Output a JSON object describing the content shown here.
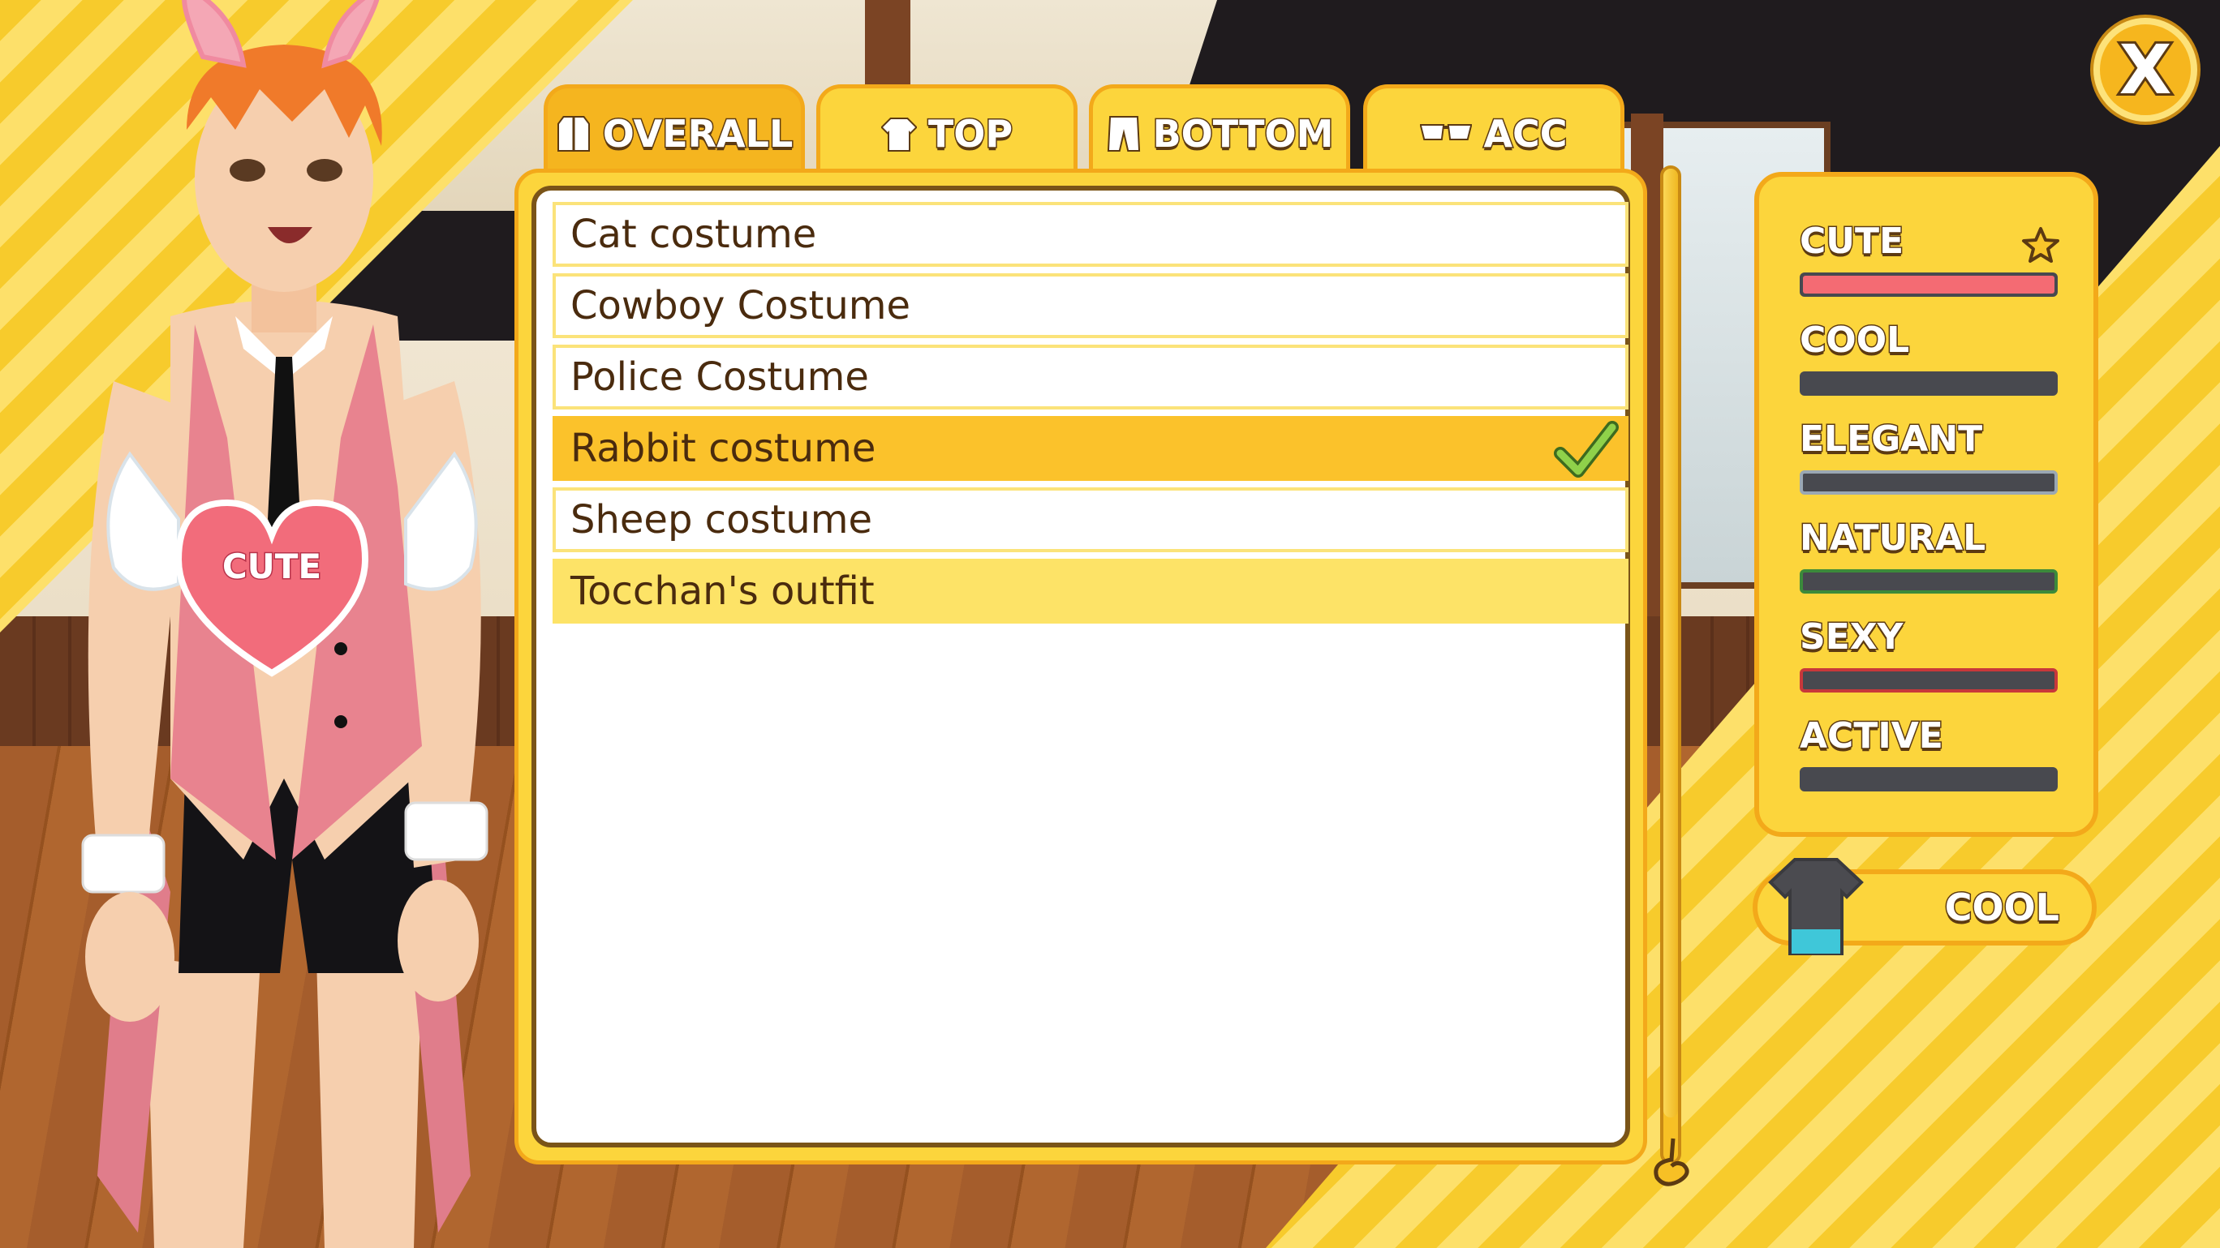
{
  "tabs": [
    {
      "label": "OVERALL",
      "icon": "overall-icon",
      "active": true
    },
    {
      "label": "TOP",
      "icon": "shirt-icon",
      "active": false
    },
    {
      "label": "BOTTOM",
      "icon": "pants-icon",
      "active": false
    },
    {
      "label": "ACC",
      "icon": "glasses-icon",
      "active": false
    }
  ],
  "outfits": [
    {
      "name": "Cat costume",
      "state": "normal"
    },
    {
      "name": "Cowboy Costume",
      "state": "normal"
    },
    {
      "name": "Police Costume",
      "state": "normal"
    },
    {
      "name": "Rabbit costume",
      "state": "selected"
    },
    {
      "name": "Sheep costume",
      "state": "normal"
    },
    {
      "name": "Tocchan's outfit",
      "state": "hover"
    }
  ],
  "character": {
    "style_badge": "CUTE"
  },
  "stats": [
    {
      "label": "CUTE",
      "color": "#f46b73",
      "value": 1.0,
      "starred": true
    },
    {
      "label": "COOL",
      "color": "#6f8ea6",
      "value": 0.0
    },
    {
      "label": "ELEGANT",
      "color": "#9aa7b3",
      "value": 0.0
    },
    {
      "label": "NATURAL",
      "color": "#3c8a3a",
      "value": 0.0
    },
    {
      "label": "SEXY",
      "color": "#c8383a",
      "value": 0.0
    },
    {
      "label": "ACTIVE",
      "color": "#6b7a86",
      "value": 0.0
    }
  ],
  "style": {
    "label": "COOL"
  },
  "close_label": "X"
}
